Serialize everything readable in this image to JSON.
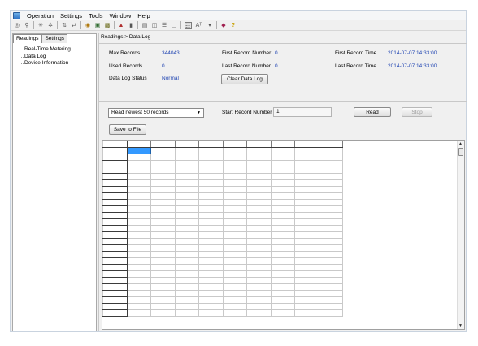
{
  "menu": [
    "Operation",
    "Settings",
    "Tools",
    "Window",
    "Help"
  ],
  "toolbar_icons": [
    "connect-icon",
    "disconnect-icon",
    "tool-3-icon",
    "tool-4-icon",
    "tool-5-icon",
    "tool-6-icon",
    "globe-icon",
    "monitor-icon",
    "chart-icon",
    "meter-icon",
    "battery-icon",
    "grid-icon",
    "table-icon",
    "list-icon",
    "dash-icon",
    "tree-icon",
    "font-icon",
    "dropdown-icon",
    "book-icon",
    "help-icon"
  ],
  "tabs": [
    "Readings",
    "Settings"
  ],
  "tree": [
    "Real-Time Metering",
    "Data Log",
    "Device Information"
  ],
  "breadcrumb": "Readings > Data Log",
  "info": {
    "max_records_label": "Max Records",
    "max_records": "344043",
    "used_records_label": "Used Records",
    "used_records": "0",
    "status_label": "Data Log Status",
    "status": "Normal",
    "first_record_number_label": "First Record Number",
    "first_record_number": "0",
    "last_record_number_label": "Last Record Number",
    "last_record_number": "0",
    "first_record_time_label": "First Record Time",
    "first_record_time": "2014-07-07 14:33:00",
    "last_record_time_label": "Last Record Time",
    "last_record_time": "2014-07-07 14:33:00",
    "clear_button": "Clear Data Log"
  },
  "controls": {
    "read_option": "Read newest 50 records",
    "start_record_label": "Start Record Number",
    "start_record_value": "1",
    "read_button": "Read",
    "stop_button": "Stop",
    "save_button": "Save to File"
  },
  "colors": {
    "value_blue": "#2448b3",
    "selection": "#3399ff"
  }
}
